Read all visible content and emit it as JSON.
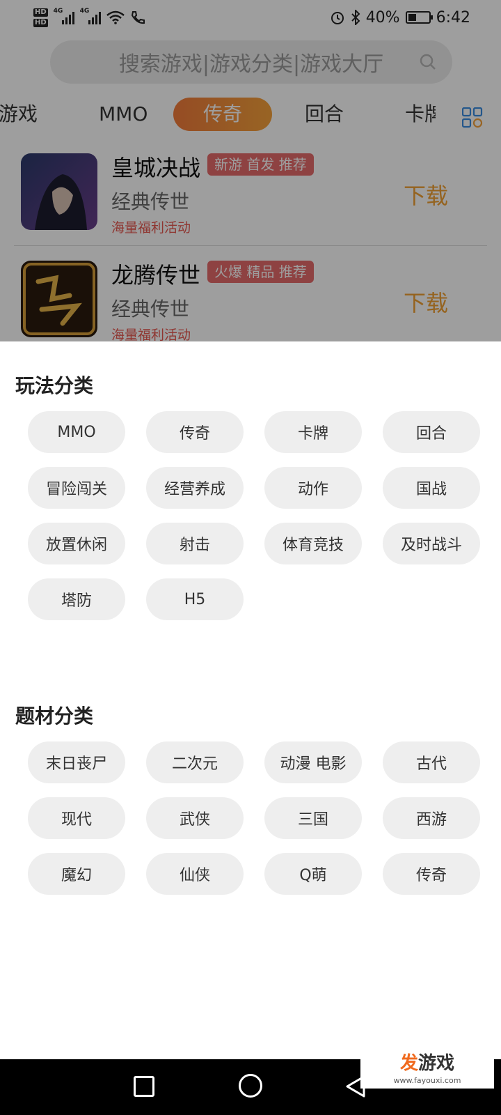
{
  "status_bar": {
    "network_left": "HD",
    "signal_labels": [
      "4G",
      "4G"
    ],
    "battery": "40%",
    "battery_level": 0.4,
    "time": "6:42"
  },
  "search": {
    "placeholder": "搜索游戏|游戏分类|游戏大厅"
  },
  "tabs": [
    {
      "label": "游戏",
      "active": false
    },
    {
      "label": "MMO",
      "active": false
    },
    {
      "label": "传奇",
      "active": true
    },
    {
      "label": "回合",
      "active": false
    },
    {
      "label": "卡牌",
      "active": false
    }
  ],
  "games": [
    {
      "name": "皇城决战",
      "tags": "新游 首发 推荐",
      "subtitle": "经典传世",
      "activity": "海量福利活动",
      "download_label": "下载"
    },
    {
      "name": "龙腾传世",
      "tags": "火爆 精品 推荐",
      "subtitle": "经典传世",
      "activity": "海量福利活动",
      "download_label": "下载"
    }
  ],
  "sheet": {
    "gameplay_title": "玩法分类",
    "gameplay": [
      "MMO",
      "传奇",
      "卡牌",
      "回合",
      "冒险闯关",
      "经营养成",
      "动作",
      "国战",
      "放置休闲",
      "射击",
      "体育竞技",
      "及时战斗",
      "塔防",
      "H5"
    ],
    "theme_title": "题材分类",
    "themes": [
      "末日丧尸",
      "二次元",
      "动漫 电影",
      "古代",
      "现代",
      "武侠",
      "三国",
      "西游",
      "魔幻",
      "仙侠",
      "Q萌",
      "传奇"
    ]
  },
  "watermark": {
    "accent": "发",
    "brand": "游戏",
    "url": "www.fayouxi.com"
  },
  "colors": {
    "accent_orange": "#f5a23b",
    "tag_red": "#e66b6b",
    "download_orange": "#f0a033",
    "chip_bg": "#eeeeee"
  }
}
